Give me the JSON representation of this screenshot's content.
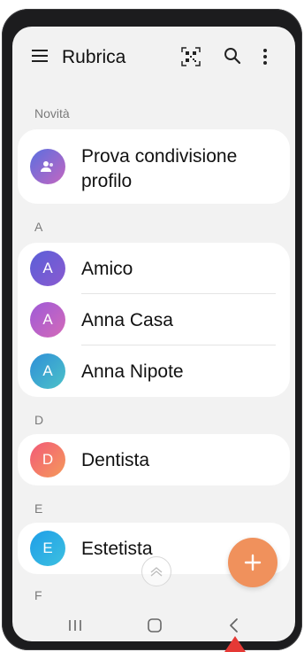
{
  "app": {
    "title": "Rubrica"
  },
  "icons": {
    "menu": "menu-icon",
    "qr": "qr-code-icon",
    "search": "search-icon",
    "more": "more-vertical-icon",
    "add": "plus-icon",
    "scroll_top": "chevron-up-icon",
    "nav_recents": "recents-icon",
    "nav_home": "home-icon",
    "nav_back": "back-icon"
  },
  "sections": {
    "novita": {
      "label": "Novità",
      "items": [
        {
          "name_line1": "Prova condivisione",
          "name_line2": "profilo",
          "avatar_color": "#7e6cd8"
        }
      ]
    },
    "a": {
      "label": "A",
      "items": [
        {
          "initial": "A",
          "name": "Amico",
          "avatar_color": "#6a5acd"
        },
        {
          "initial": "A",
          "name": "Anna Casa",
          "avatar_color": "#b65fc8"
        },
        {
          "initial": "A",
          "name": "Anna Nipote",
          "avatar_color": "#3da9d0"
        }
      ]
    },
    "d": {
      "label": "D",
      "items": [
        {
          "initial": "D",
          "name": "Dentista",
          "avatar_color": "#f06a6a"
        }
      ]
    },
    "e": {
      "label": "E",
      "items": [
        {
          "initial": "E",
          "name": "Estetista",
          "avatar_color": "#2fa6e0"
        }
      ]
    },
    "f": {
      "label": "F"
    }
  },
  "colors": {
    "fab": "#f0915c",
    "background": "#f2f2f2"
  }
}
